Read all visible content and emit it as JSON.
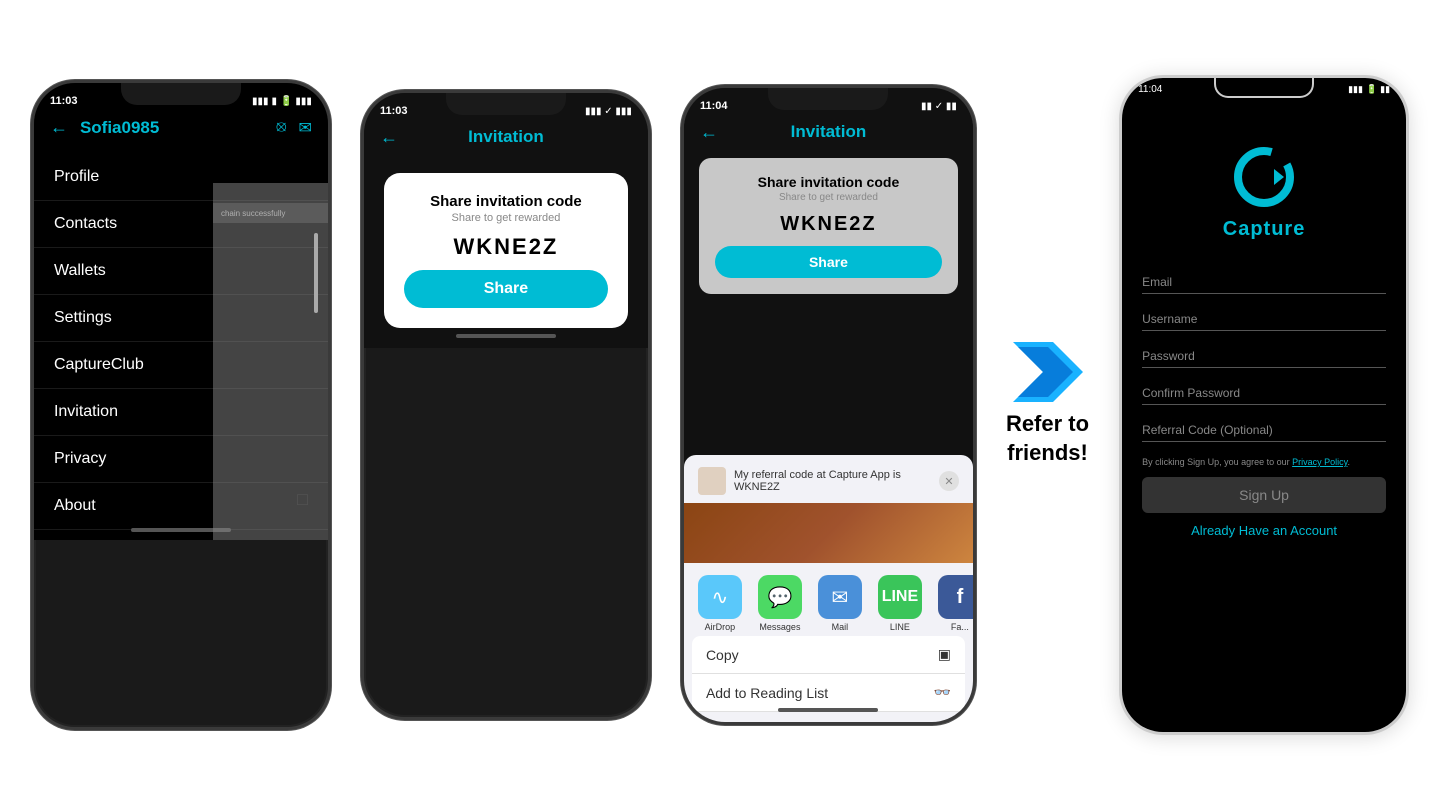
{
  "phone1": {
    "time": "11:03",
    "title": "Sofia0985",
    "menu_items": [
      {
        "label": "Profile"
      },
      {
        "label": "Contacts"
      },
      {
        "label": "Wallets"
      },
      {
        "label": "Settings"
      },
      {
        "label": "CaptureClub"
      },
      {
        "label": "Invitation"
      },
      {
        "label": "Privacy"
      },
      {
        "label": "About"
      }
    ],
    "side_text": "chain successfully"
  },
  "phone2": {
    "time": "11:03",
    "title": "Invitation",
    "card": {
      "title": "Share invitation code",
      "subtitle": "Share to get rewarded",
      "code": "WKNE2Z",
      "share_button": "Share"
    }
  },
  "phone3": {
    "time": "11:04",
    "title": "Invitation",
    "card": {
      "title": "Share invitation code",
      "subtitle": "Share to get rewarded",
      "code": "WKNE2Z",
      "share_button": "Share"
    },
    "sheet": {
      "preview_text": "My referral code at Capture App is WKNE2Z",
      "apps": [
        {
          "name": "AirDrop",
          "color": "#5AC8FA"
        },
        {
          "name": "Messages",
          "color": "#4CD964"
        },
        {
          "name": "Mail",
          "color": "#4A90D9"
        },
        {
          "name": "LINE",
          "color": "#3AC55A"
        },
        {
          "name": "Fa...",
          "color": "#3b5998"
        }
      ],
      "rows": [
        {
          "label": "Copy"
        },
        {
          "label": "Add to Reading List"
        }
      ]
    }
  },
  "arrow": {
    "refer_text": "Refer to\nfriends!"
  },
  "phone4": {
    "time": "11:04",
    "logo_label": "Capture",
    "form": {
      "email_label": "Email",
      "username_label": "Username",
      "password_label": "Password",
      "confirm_password_label": "Confirm Password",
      "referral_label": "Referral Code (Optional)",
      "terms_prefix": "By clicking Sign Up, you agree to our ",
      "terms_link": "Privacy Policy",
      "terms_suffix": ".",
      "signup_button": "Sign Up",
      "already_account": "Already Have an Account"
    }
  }
}
